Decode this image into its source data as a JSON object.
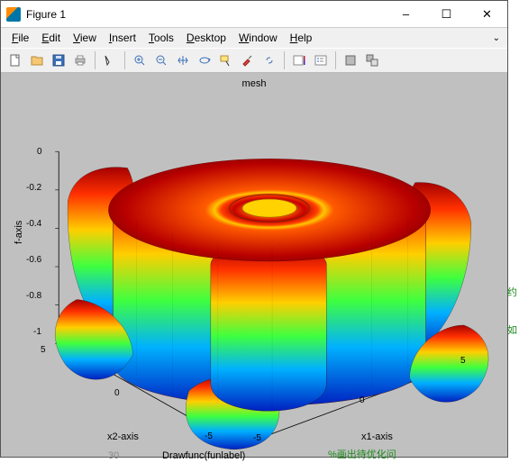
{
  "window": {
    "title": "Figure 1",
    "min_label": "–",
    "max_label": "☐",
    "close_label": "✕"
  },
  "menu": {
    "file": "File",
    "edit": "Edit",
    "view": "View",
    "insert": "Insert",
    "tools": "Tools",
    "desktop": "Desktop",
    "window": "Window",
    "help": "Help"
  },
  "chart_data": {
    "type": "surface",
    "title": "mesh",
    "xlabel": "x1-axis",
    "ylabel": "x2-axis",
    "zlabel": "f-axis",
    "xlim": [
      -5,
      5
    ],
    "ylim": [
      -5,
      5
    ],
    "zlim": [
      -1,
      0
    ],
    "xticks": [
      -5,
      0,
      5
    ],
    "yticks": [
      -5,
      0,
      5
    ],
    "zticks": [
      0,
      -0.2,
      -0.4,
      -0.6,
      -0.8,
      -1
    ],
    "colormap": "jet",
    "description": "3-D rotationally symmetric surface over a square domain. The surface has a wide outer annular plateau near z≈0 with a smaller inner annular ring and a shallow central dip. Toward the four corners of the domain the surface plunges to z≈-1 forming deep lobes; along the axis midpoints the wall stays near z≈0. Coloring follows height (jet: deep blue at -1 through cyan, green, yellow to red at 0).",
    "sample_profile_along_diagonal": {
      "r": [
        0.0,
        0.6,
        1.2,
        1.8,
        3.5,
        5.5,
        6.5,
        7.07
      ],
      "z": [
        -0.1,
        -0.02,
        -0.08,
        -0.01,
        -0.01,
        -0.05,
        -0.6,
        -1.0
      ]
    }
  },
  "behind_text": {
    "a": "约",
    "b": "如",
    "c": "30",
    "d": "Drawfunc(funlabel)",
    "e": "%画出待优化问"
  }
}
